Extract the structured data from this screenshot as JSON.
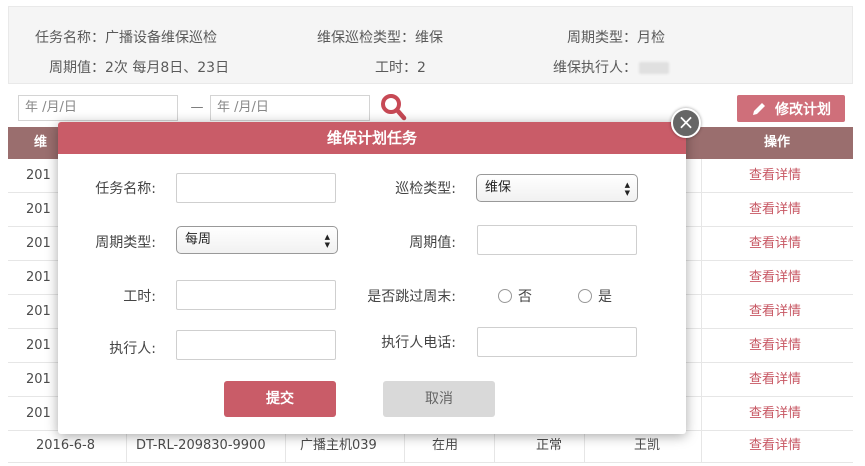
{
  "info": {
    "task_name_label": "任务名称：",
    "task_name_value": "广播设备维保巡检",
    "inspect_type_label": "维保巡检类型：",
    "inspect_type_value": "维保",
    "cycle_type_label": "周期类型：",
    "cycle_type_value": "月检",
    "cycle_value_label": "周期值：",
    "cycle_value_value": "2次 每月8日、23日",
    "work_hours_label": "工时：",
    "work_hours_value": "2",
    "executor_label": "维保执行人："
  },
  "filter": {
    "date_from_placeholder": "年 /月/日",
    "date_to_placeholder": "年 /月/日",
    "dash": "—",
    "edit_plan_label": "修改计划"
  },
  "table": {
    "headers": [
      "维",
      "操作"
    ],
    "row_prefixes": [
      "201",
      "201",
      "201",
      "201",
      "201",
      "201",
      "201",
      "201"
    ],
    "detail_label": "查看详情",
    "last_row": {
      "date": "2016-6-8",
      "code": "DT-RL-209830-9900",
      "device": "广播主机039",
      "status": "在用",
      "state": "正常",
      "person": "王凯",
      "action": "查看详情"
    }
  },
  "modal": {
    "title": "维保计划任务",
    "close_symbol": "×",
    "task_name_label": "任务名称:",
    "task_name_value": "",
    "inspect_type_label": "巡检类型:",
    "inspect_type_value": "维保",
    "cycle_type_label": "周期类型:",
    "cycle_type_value": "每周",
    "cycle_value_label": "周期值:",
    "cycle_value_value": "",
    "work_hours_label": "工时:",
    "work_hours_value": "",
    "skip_weekend_label": "是否跳过周末:",
    "radio_no": "否",
    "radio_yes": "是",
    "executor_label": "执行人:",
    "executor_value": "",
    "executor_phone_label": "执行人电话:",
    "executor_phone_value": "",
    "submit_label": "提交",
    "cancel_label": "取消"
  },
  "colors": {
    "accent": "#c95c68",
    "table_header": "#8c5b5b",
    "link": "#c0404e"
  }
}
